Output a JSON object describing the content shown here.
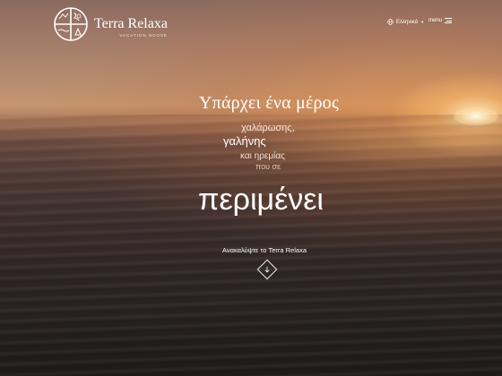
{
  "header": {
    "logo_name": "Terra Relaxa",
    "logo_tagline": "VACATION HOUSE",
    "language_label": "Ελληνικά",
    "language_icon": "globe-icon",
    "menu_label": "menu",
    "menu_icon": "hamburger-icon"
  },
  "hero": {
    "line1": "Υπάρχει ένα μέρος",
    "words": {
      "w1": "χαλάρωσης,",
      "w2": "γαλήνης",
      "w3": "και ηρεμίας",
      "w4": "που σε"
    },
    "big": "περιμένει",
    "cta_label": "Ανακαλύψτε το Terra Relaxa",
    "scroll_icon": "arrow-down-icon"
  },
  "colors": {
    "text": "#ffffff",
    "sun": "#ffe9b8",
    "sea_dark": "#242121"
  }
}
